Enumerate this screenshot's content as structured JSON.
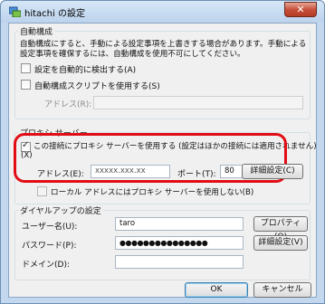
{
  "window": {
    "title": "hitachi の設定",
    "close_label": "✕"
  },
  "auto_config": {
    "group_label": "自動構成",
    "description_line1": "自動構成にすると、手動による設定事項を上書きする場合があります。手動による",
    "description_line2": "設定事項を確保するには、自動構成を使用不可にしてください。",
    "auto_detect_label": "設定を自動的に検出する(A)",
    "auto_detect_checked": false,
    "use_script_label": "自動構成スクリプトを使用する(S)",
    "use_script_checked": false,
    "address_label": "アドレス(R):",
    "address_value": ""
  },
  "proxy": {
    "group_label": "プロキシ サーバー",
    "use_proxy_label": "この接続にプロキシ サーバーを使用する (設定はほかの接続には適用されません)",
    "use_proxy_accel": "(X)",
    "use_proxy_checked": true,
    "address_label": "アドレス(E):",
    "address_value": "xxxxx.xxx.xx",
    "port_label": "ポート(T):",
    "port_value": "80",
    "advanced_button": "詳細設定(C)",
    "bypass_local_label": "ローカル アドレスにはプロキシ サーバーを使用しない(B)",
    "bypass_local_checked": false
  },
  "dialup": {
    "group_label": "ダイヤルアップの設定",
    "username_label": "ユーザー名(U):",
    "username_value": "taro",
    "properties_button": "プロパティ(O)",
    "password_label": "パスワード(P):",
    "password_value": "●●●●●●●●●●●●●●●",
    "advanced_button": "詳細設定(V)",
    "domain_label": "ドメイン(D):",
    "domain_value": ""
  },
  "footer": {
    "ok_button": "OK",
    "cancel_button": "キャンセル"
  }
}
